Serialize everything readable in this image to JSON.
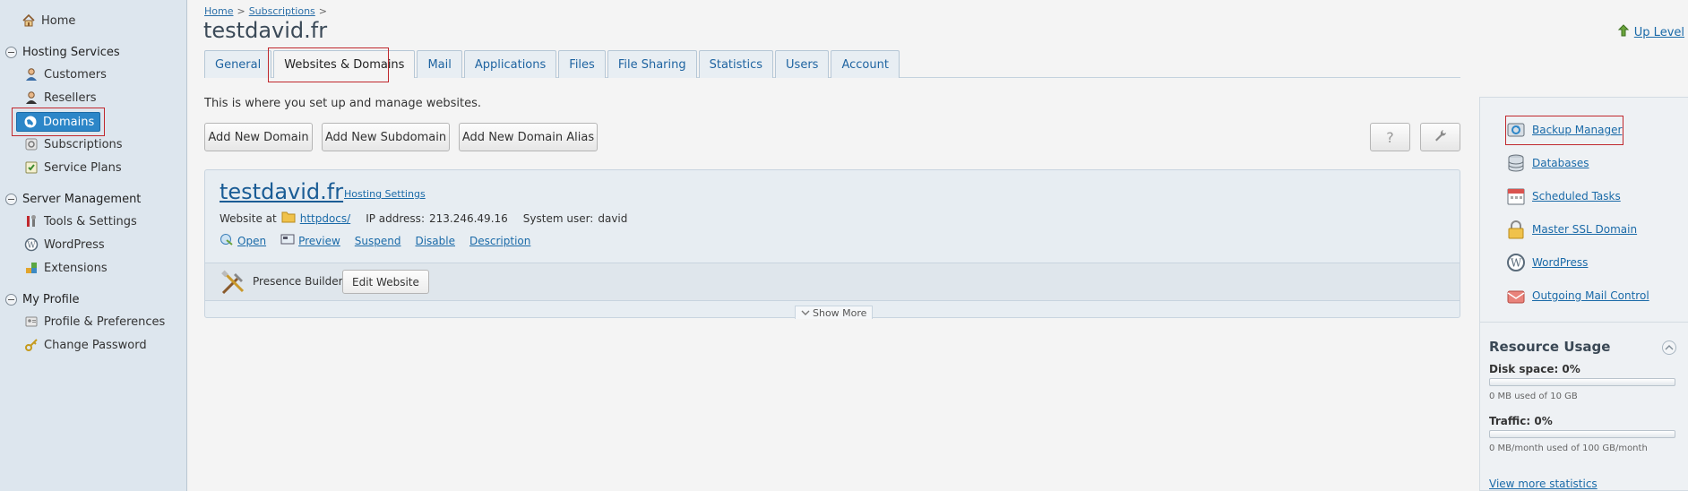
{
  "sidebar": {
    "home": "Home",
    "hosting_services": {
      "label": "Hosting Services",
      "items": [
        "Customers",
        "Resellers",
        "Domains",
        "Subscriptions",
        "Service Plans"
      ]
    },
    "server_management": {
      "label": "Server Management",
      "items": [
        "Tools & Settings",
        "WordPress",
        "Extensions"
      ]
    },
    "my_profile": {
      "label": "My Profile",
      "items": [
        "Profile & Preferences",
        "Change Password"
      ]
    }
  },
  "breadcrumb": {
    "home": "Home",
    "subscriptions": "Subscriptions",
    "sep": ">"
  },
  "page_title": "testdavid.fr",
  "up_level": "Up Level",
  "tabs": [
    "General",
    "Websites & Domains",
    "Mail",
    "Applications",
    "Files",
    "File Sharing",
    "Statistics",
    "Users",
    "Account"
  ],
  "intro": "This is where you set up and manage websites.",
  "buttons": {
    "add_domain": "Add New Domain",
    "add_subdomain": "Add New Subdomain",
    "add_alias": "Add New Domain Alias",
    "help": "?"
  },
  "domain": {
    "name": "testdavid.fr",
    "hosting_settings": "Hosting Settings",
    "website_at": "Website at",
    "docroot": "httpdocs/",
    "ip_label": "IP address:",
    "ip": "213.246.49.16",
    "user_label": "System user:",
    "user": "david",
    "actions": {
      "open": "Open",
      "preview": "Preview",
      "suspend": "Suspend",
      "disable": "Disable",
      "description": "Description"
    },
    "presence_builder": "Presence Builder",
    "edit_website": "Edit Website",
    "show_more": "Show More"
  },
  "tools": [
    "Backup Manager",
    "Databases",
    "Scheduled Tasks",
    "Master SSL Domain",
    "WordPress",
    "Outgoing Mail Control"
  ],
  "resources": {
    "title": "Resource Usage",
    "disk_label": "Disk space: 0%",
    "disk_percent": 0,
    "disk_note": "0 MB used of 10 GB",
    "traffic_label": "Traffic: 0%",
    "traffic_percent": 0,
    "traffic_note": "0 MB/month used of 100 GB/month",
    "more_stats": "View more statistics"
  },
  "colors": {
    "accent": "#2c86c8",
    "link": "#1a6aa8",
    "highlight": "#c0282d"
  }
}
